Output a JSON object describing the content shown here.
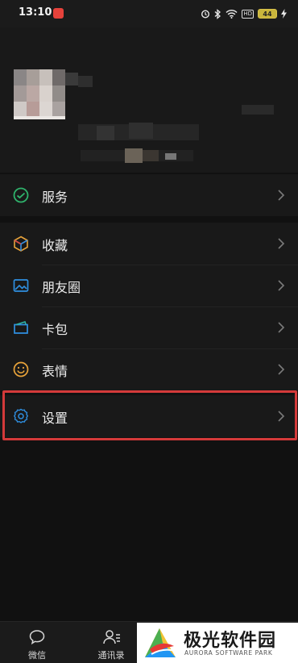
{
  "status_bar": {
    "time": "13:10",
    "battery": "44",
    "hd": "HD"
  },
  "menu": {
    "services": {
      "label": "服务",
      "icon": "services-icon"
    },
    "favorites": {
      "label": "收藏",
      "icon": "favorites-cube-icon"
    },
    "moments": {
      "label": "朋友圈",
      "icon": "moments-image-icon"
    },
    "cards": {
      "label": "卡包",
      "icon": "card-icon"
    },
    "stickers": {
      "label": "表情",
      "icon": "smiley-icon"
    },
    "settings": {
      "label": "设置",
      "icon": "gear-icon"
    }
  },
  "bottom_nav": {
    "chats": "微信",
    "contacts": "通讯录"
  },
  "watermark": {
    "title": "极光软件园",
    "subtitle": "AURORA SOFTWARE PARK"
  },
  "colors": {
    "background": "#111111",
    "panel": "#191919",
    "highlight": "#d43a3a",
    "services_green": "#2fb36c",
    "accent_blue": "#2f8fe0",
    "stickers_orange": "#e8a33a"
  }
}
